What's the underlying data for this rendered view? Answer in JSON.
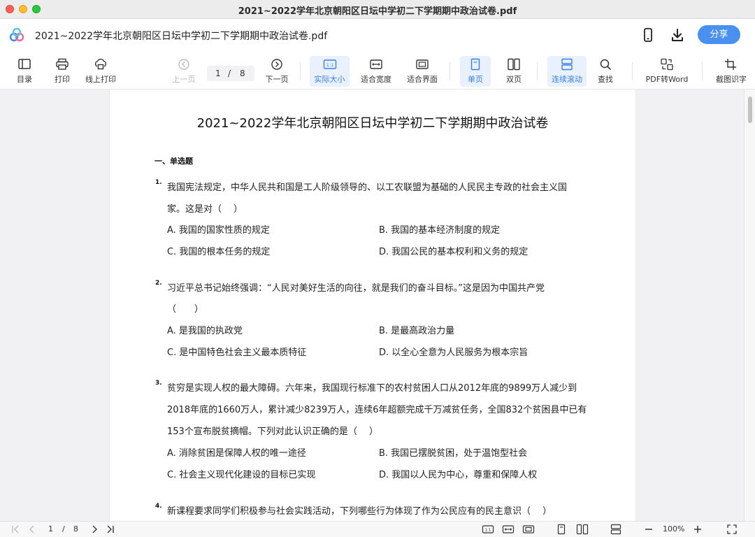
{
  "window": {
    "title": "2021~2022学年北京朝阳区日坛中学初二下学期期中政治试卷.pdf"
  },
  "header": {
    "doc_title": "2021~2022学年北京朝阳区日坛中学初二下学期期中政治试卷.pdf",
    "share_label": "分享",
    "accent_color": "#4a90f0"
  },
  "toolbar": {
    "toc": "目录",
    "print": "打印",
    "online_print": "线上打印",
    "prev_page": "上一页",
    "current_page": "1",
    "page_separator": "/",
    "total_pages": "8",
    "next_page": "下一页",
    "actual_size": "实际大小",
    "fit_width": "适合宽度",
    "fit_page": "适合界面",
    "single_page": "单页",
    "double_page": "双页",
    "continuous_scroll": "连续滚动",
    "find": "查找",
    "pdf_to_word": "PDF转Word",
    "ocr": "截图识字",
    "actual_size_icon_text": "1:1"
  },
  "document": {
    "title": "2021~2022学年北京朝阳区日坛中学初二下学期期中政治试卷",
    "section": "一、单选题",
    "questions": [
      {
        "num": "1.",
        "lines": [
          "我国宪法规定，中华人民共和国是工人阶级领导的、以工农联盟为基础的人民民主专政的社会主义国",
          "家。这是对（　 ）"
        ],
        "options": [
          "A. 我国的国家性质的规定",
          "B. 我国的基本经济制度的规定",
          "C. 我国的根本任务的规定",
          "D. 我国公民的基本权利和义务的规定"
        ]
      },
      {
        "num": "2.",
        "lines": [
          "习近平总书记始终强调：“人民对美好生活的向往，就是我们的奋斗目标。”这是因为中国共产党",
          " （　　）"
        ],
        "options": [
          "A. 是我国的执政党",
          "B. 是最高政治力量",
          "C. 是中国特色社会主义最本质特征",
          "D. 以全心全意为人民服务为根本宗旨"
        ]
      },
      {
        "num": "3.",
        "lines": [
          "贫穷是实现人权的最大障碍。六年来，我国现行标准下的农村贫困人口从2012年底的9899万人减少到",
          "2018年底的1660万人，累计减少8239万人，连续6年超额完成千万减贫任务，全国832个贫困县中已有",
          "153个宣布脱贫摘帽。下列对此认识正确的是（　 ）"
        ],
        "options": [
          "A. 消除贫困是保障人权的唯一途径",
          "B. 我国已摆脱贫困，处于温饱型社会",
          "C. 社会主义现代化建设的目标已实现",
          "D. 我国以人民为中心，尊重和保障人权"
        ]
      },
      {
        "num": "4.",
        "lines": [
          "新课程要求同学们积极参与社会实践活动，下列哪些行为体现了作为公民应有的民主意识（　 ）"
        ],
        "options": []
      }
    ]
  },
  "bottombar": {
    "current_page": "1",
    "page_separator": "/",
    "total_pages": "8",
    "zoom": "100%",
    "actual_size_icon_text": "1:1"
  }
}
